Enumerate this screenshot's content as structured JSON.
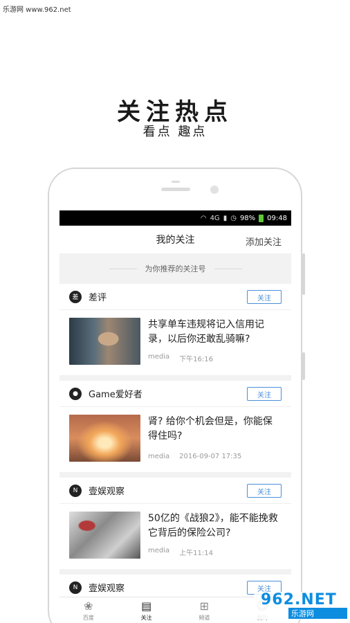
{
  "watermark_top": "乐游网 www.962.net",
  "hero": {
    "title": "关注热点",
    "subtitle": "看点 趣点"
  },
  "statusbar": {
    "network": "4G",
    "battery": "98%",
    "time": "09:48"
  },
  "navbar": {
    "title": "我的关注",
    "action": "添加关注"
  },
  "section_header": "为你推荐的关注号",
  "accounts": [
    {
      "logo": "差",
      "name": "差评",
      "follow_label": "关注",
      "article": {
        "title": "共享单车违规将记入信用记录，以后你还敢乱骑嘛?",
        "source": "media",
        "time": "下午16:16"
      }
    },
    {
      "logo": "●",
      "name": "Game爱好者",
      "follow_label": "关注",
      "article": {
        "title": "肾? 给你个机会但是，你能保得住吗?",
        "source": "media",
        "time": "2016-09-07 17:35"
      }
    },
    {
      "logo": "N",
      "name": "壹娱观察",
      "follow_label": "关注",
      "article": {
        "title": "50亿的《战狼2》，能不能挽救它背后的保险公司?",
        "source": "media",
        "time": "上午11:14"
      }
    },
    {
      "logo": "N",
      "name": "壹娱观察",
      "follow_label": "关注"
    }
  ],
  "tabs": [
    {
      "label": "百度",
      "icon": "paw-icon"
    },
    {
      "label": "关注",
      "icon": "document-icon"
    },
    {
      "label": "频道",
      "icon": "grid-icon"
    },
    {
      "label": "我的",
      "icon": "user-icon"
    }
  ],
  "watermark_br": {
    "logo_a": "962",
    "logo_b": ".NET",
    "sub": "乐游网"
  }
}
